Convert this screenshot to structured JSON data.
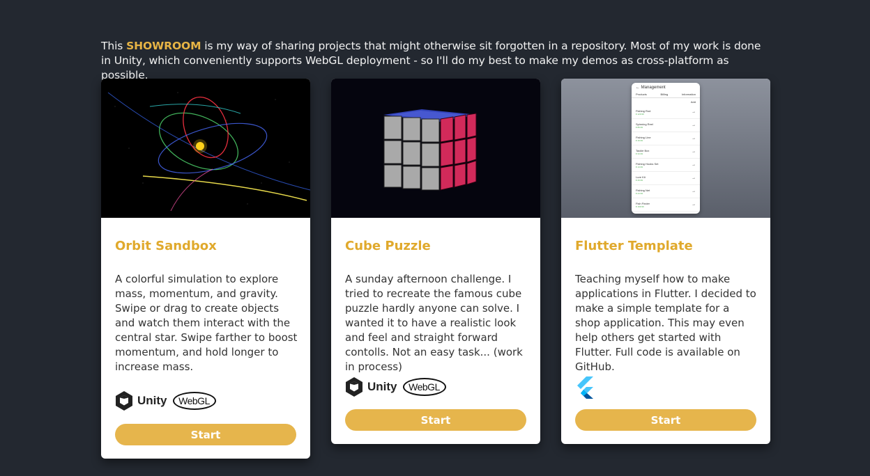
{
  "intro": {
    "before": "This ",
    "highlight": "SHOWROOM",
    "after": " is my way of sharing projects that might otherwise sit forgotten in a repository. Most of my work is done in Unity, which conveniently supports WebGL deployment - so I'll do my best to make my demos as cross-platform as possible."
  },
  "colors": {
    "background": "#232830",
    "accent": "#e6b54c",
    "title": "#e0a92c"
  },
  "cards": [
    {
      "title": "Orbit Sandbox",
      "description": "A colorful simulation to explore mass, momentum, and gravity. Swipe or drag to create objects and watch them interact with the central star. Swipe farther to boost momentum, and hold longer to increase mass.",
      "logos": [
        "unity-icon",
        "webgl-icon"
      ],
      "unity_label": "Unity",
      "webgl_label": "WebGL",
      "button": "Start"
    },
    {
      "title": "Cube Puzzle",
      "description": "A sunday afternoon challenge. I tried to recreate the famous cube puzzle hardly anyone can solve. I wanted it to have a realistic look and feel and straight forward contolls. Not an easy task... (work in process)",
      "logos": [
        "unity-icon",
        "webgl-icon"
      ],
      "unity_label": "Unity",
      "webgl_label": "WebGL",
      "button": "Start"
    },
    {
      "title": "Flutter Template",
      "description": "Teaching myself how to make applications in Flutter. I decided to make a simple template for a shop application. This may even help others get started with Flutter. Full code is available on GitHub.",
      "logos": [
        "flutter-icon"
      ],
      "button": "Start",
      "phone": {
        "header": "Management",
        "tabs": [
          "Products",
          "Billing",
          "Information"
        ],
        "add": "Add",
        "items": [
          {
            "name": "Fishing Rod",
            "price": "€ 129.99"
          },
          {
            "name": "Spinning Reel",
            "price": "€ 89.99"
          },
          {
            "name": "Fishing Line",
            "price": "€ 19.99"
          },
          {
            "name": "Tackle Box",
            "price": "€ 34.99"
          },
          {
            "name": "Fishing Hooks Set",
            "price": "€ 14.99"
          },
          {
            "name": "Lure Kit",
            "price": "€ 29.99"
          },
          {
            "name": "Fishing Net",
            "price": "€ 24.99"
          },
          {
            "name": "Fish Finder",
            "price": "€ 199.99"
          }
        ]
      }
    }
  ]
}
